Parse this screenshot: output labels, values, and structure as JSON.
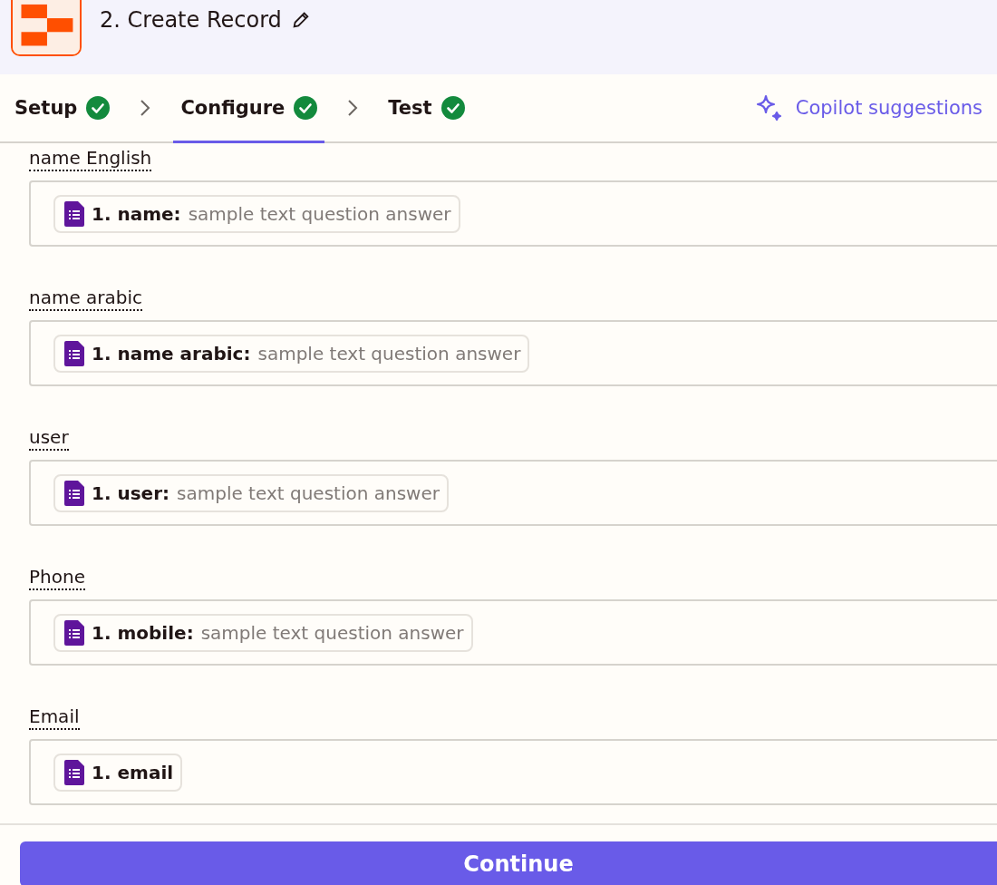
{
  "header": {
    "title": "2. Create Record"
  },
  "steps": [
    {
      "label": "Setup",
      "done": true,
      "selected": false
    },
    {
      "label": "Configure",
      "done": true,
      "selected": true
    },
    {
      "label": "Test",
      "done": true,
      "selected": false
    }
  ],
  "copilot": {
    "label": "Copilot suggestions"
  },
  "fields": [
    {
      "label": "name English",
      "chip": {
        "key": "1. name:",
        "answer": "sample text question answer"
      }
    },
    {
      "label": "name arabic",
      "chip": {
        "key": "1. name arabic:",
        "answer": "sample text question answer"
      }
    },
    {
      "label": "user",
      "chip": {
        "key": "1. user:",
        "answer": "sample text question answer"
      }
    },
    {
      "label": "Phone",
      "chip": {
        "key": "1. mobile:",
        "answer": "sample text question answer"
      }
    },
    {
      "label": "Email",
      "chip": {
        "key": "1. email"
      }
    }
  ],
  "footer": {
    "button": "Continue"
  }
}
